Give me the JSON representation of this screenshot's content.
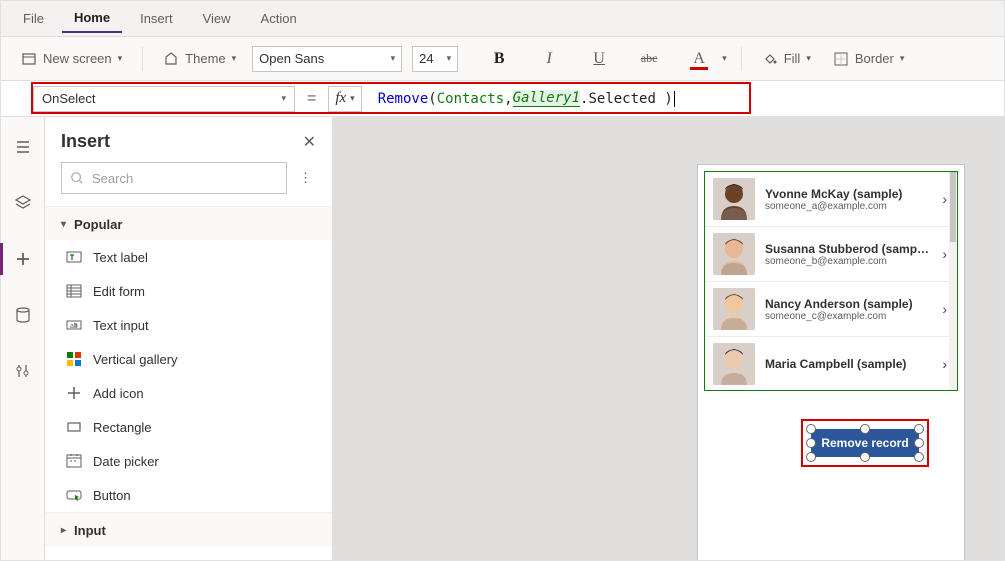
{
  "menubar": {
    "tabs": [
      "File",
      "Home",
      "Insert",
      "View",
      "Action"
    ],
    "active": "Home"
  },
  "ribbon": {
    "new_screen": "New screen",
    "theme": "Theme",
    "font_family": "Open Sans",
    "font_size": "24",
    "fill": "Fill",
    "border": "Border"
  },
  "formula": {
    "property": "OnSelect",
    "fx": "fx",
    "tokens": {
      "fn": "Remove",
      "lparen": "( ",
      "tbl": "Contacts",
      "comma": ", ",
      "gal": "Gallery1",
      "sel": ".Selected )"
    }
  },
  "insert_panel": {
    "title": "Insert",
    "search_placeholder": "Search",
    "popular_label": "Popular",
    "items": [
      {
        "label": "Text label",
        "icon": "text-label-icon"
      },
      {
        "label": "Edit form",
        "icon": "edit-form-icon"
      },
      {
        "label": "Text input",
        "icon": "text-input-icon"
      },
      {
        "label": "Vertical gallery",
        "icon": "gallery-icon"
      },
      {
        "label": "Add icon",
        "icon": "plus-icon"
      },
      {
        "label": "Rectangle",
        "icon": "rectangle-icon"
      },
      {
        "label": "Date picker",
        "icon": "date-picker-icon"
      },
      {
        "label": "Button",
        "icon": "button-icon"
      }
    ],
    "input_label": "Input"
  },
  "canvas": {
    "gallery": [
      {
        "name": "Yvonne McKay (sample)",
        "email": "someone_a@example.com",
        "skin": "#6b4226",
        "hair": "#1a1a1a"
      },
      {
        "name": "Susanna Stubberod (sample)",
        "email": "someone_b@example.com",
        "skin": "#e8b896",
        "hair": "#5c3a1e"
      },
      {
        "name": "Nancy Anderson (sample)",
        "email": "someone_c@example.com",
        "skin": "#f0c8a0",
        "hair": "#704214"
      },
      {
        "name": "Maria Campbell (sample)",
        "email": "",
        "skin": "#edc9af",
        "hair": "#3b2f2f"
      }
    ],
    "button_label": "Remove record"
  }
}
